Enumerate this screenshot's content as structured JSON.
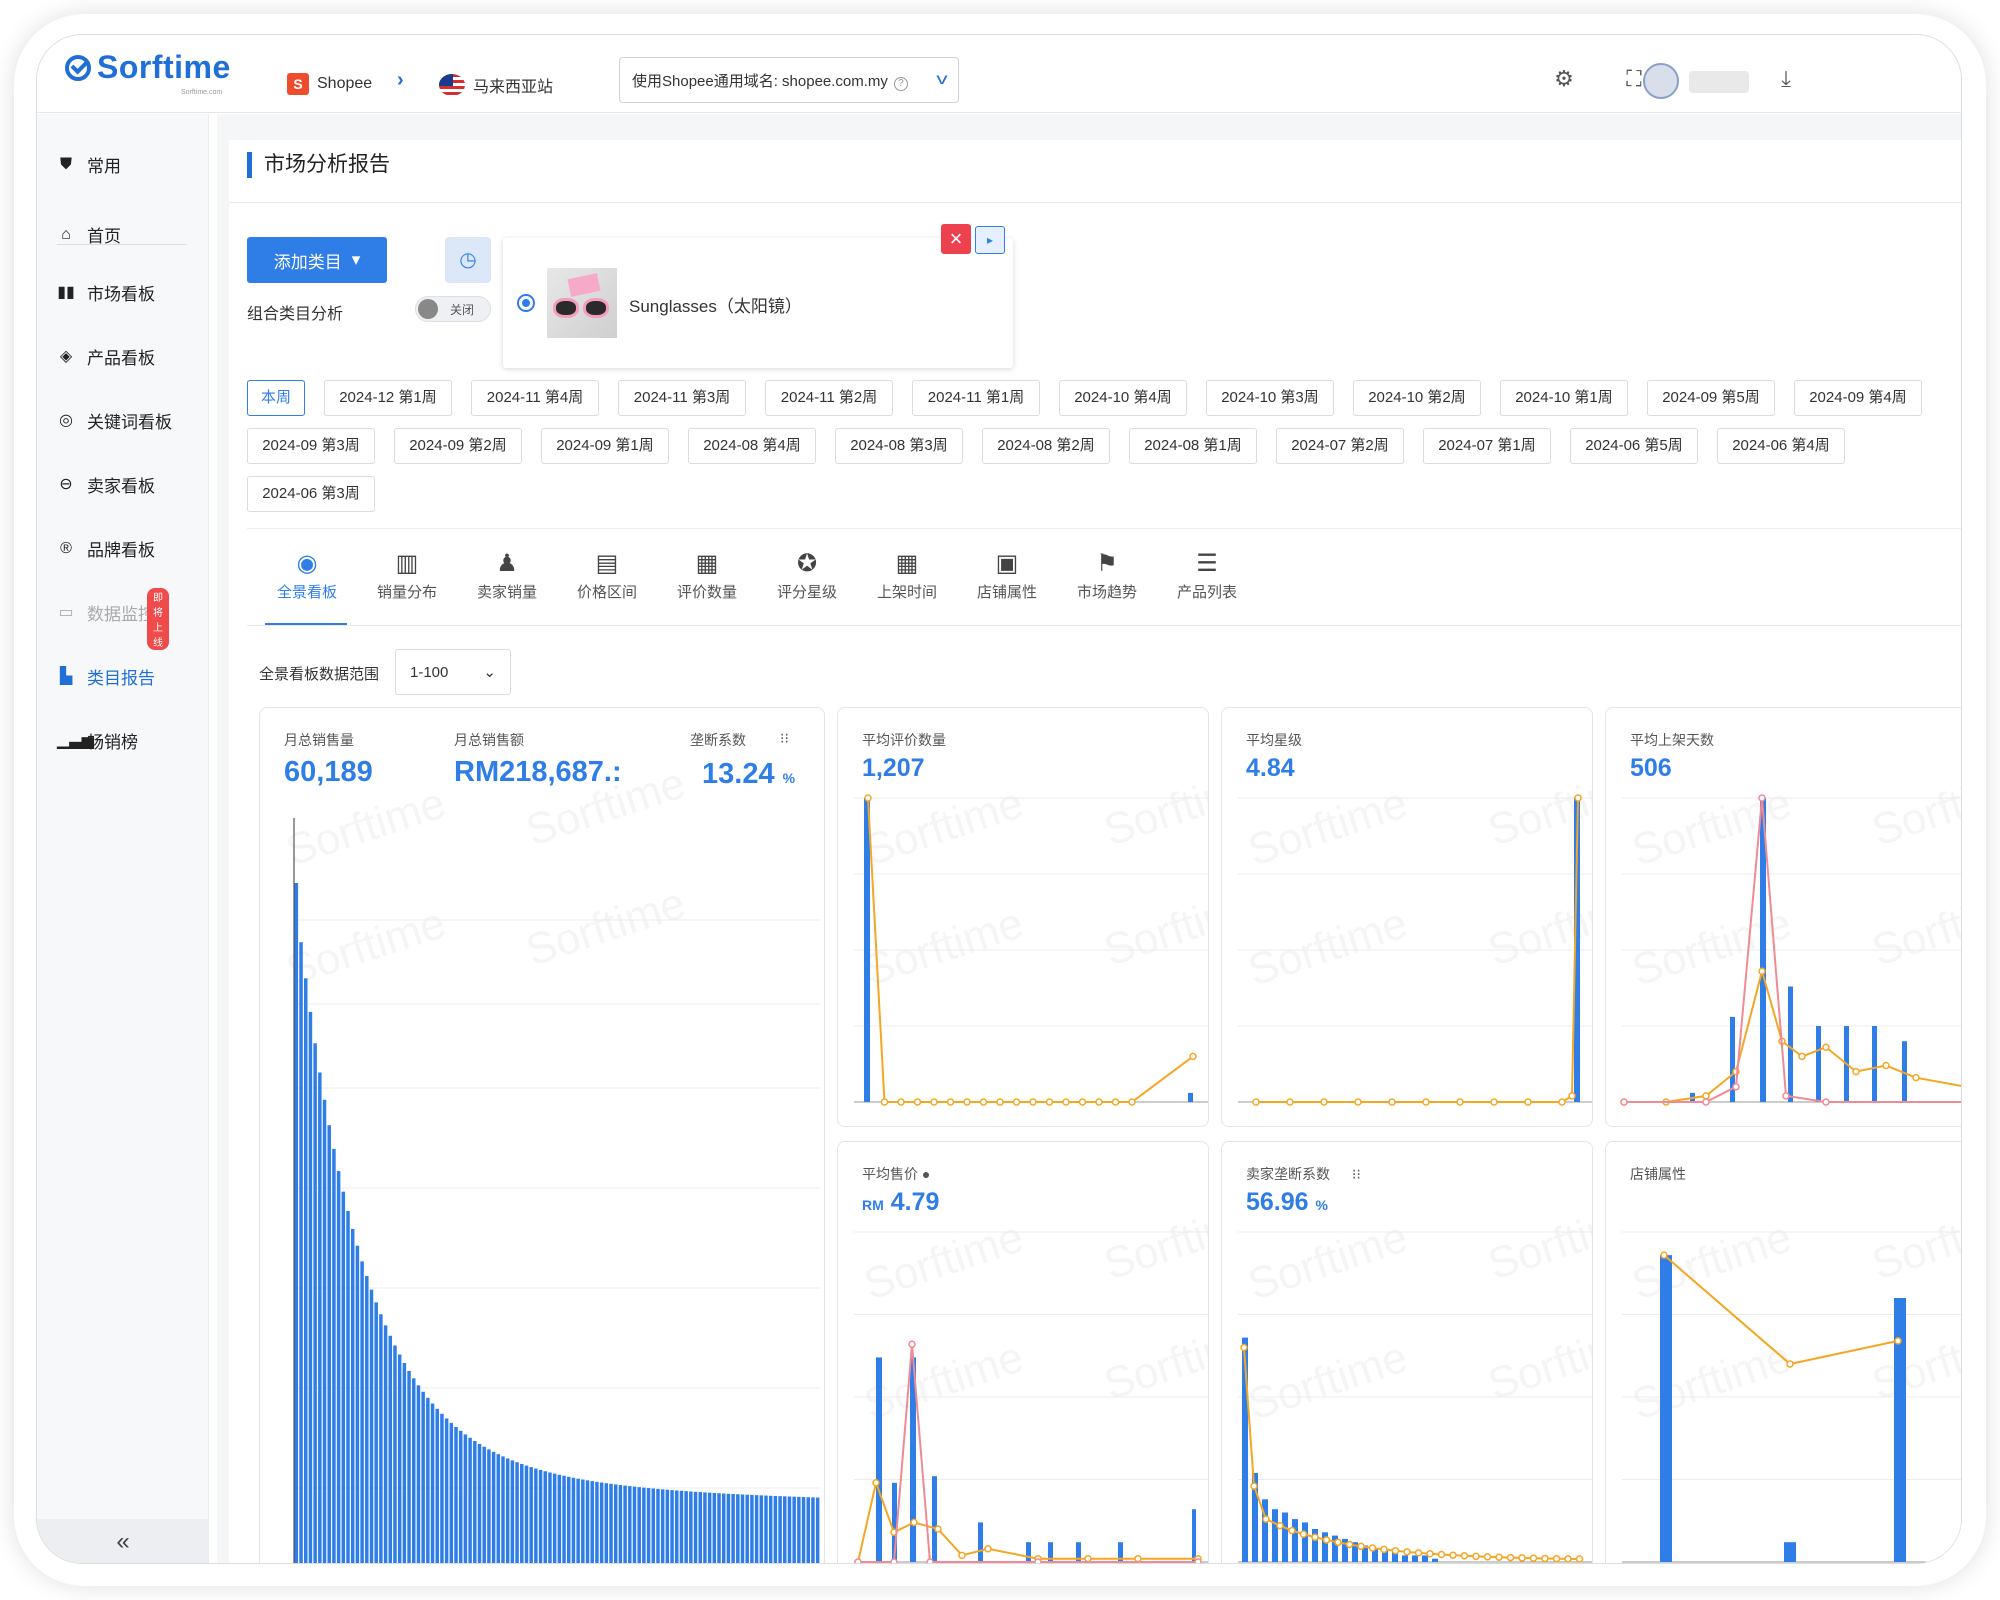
{
  "app": {
    "name": "Sorftime",
    "tagline": "Sorftime.com"
  },
  "breadcrumb": {
    "platform": "Shopee",
    "site": "马来西亚站"
  },
  "domain_select": {
    "label": "使用Shopee通用域名: shopee.com.my"
  },
  "sidebar": {
    "items": [
      {
        "label": "常用",
        "icon": "shield-icon"
      },
      {
        "label": "首页",
        "icon": "home-icon"
      },
      {
        "label": "市场看板",
        "icon": "market-icon"
      },
      {
        "label": "产品看板",
        "icon": "box-icon"
      },
      {
        "label": "关键词看板",
        "icon": "target-icon"
      },
      {
        "label": "卖家看板",
        "icon": "seller-icon"
      },
      {
        "label": "品牌看板",
        "icon": "registered-icon"
      },
      {
        "label": "数据监控",
        "icon": "monitor-icon",
        "badge": "即将上线"
      },
      {
        "label": "类目报告",
        "icon": "report-icon"
      },
      {
        "label": "畅销榜",
        "icon": "bar-chart-icon"
      }
    ],
    "collapse": "«"
  },
  "page": {
    "title": "市场分析报告"
  },
  "controls": {
    "add_category": "添加类目",
    "combo_label": "组合类目分析",
    "toggle_label": "关闭"
  },
  "category": {
    "name": "Sunglasses（太阳镜）"
  },
  "weeks": [
    "本周",
    "2024-12 第1周",
    "2024-11 第4周",
    "2024-11 第3周",
    "2024-11 第2周",
    "2024-11 第1周",
    "2024-10 第4周",
    "2024-10 第3周",
    "2024-10 第2周",
    "2024-10 第1周",
    "2024-09 第5周",
    "2024-09 第4周",
    "2024-09 第3周",
    "2024-09 第2周",
    "2024-09 第1周",
    "2024-08 第4周",
    "2024-08 第3周",
    "2024-08 第2周",
    "2024-08 第1周",
    "2024-07 第2周",
    "2024-07 第1周",
    "2024-06 第5周",
    "2024-06 第4周",
    "2024-06 第3周"
  ],
  "tabs": [
    {
      "label": "全景看板",
      "icon": "dashboard-icon"
    },
    {
      "label": "销量分布",
      "icon": "sales-chart-icon"
    },
    {
      "label": "卖家销量",
      "icon": "seller-sales-icon"
    },
    {
      "label": "价格区间",
      "icon": "price-icon"
    },
    {
      "label": "评价数量",
      "icon": "review-icon"
    },
    {
      "label": "评分星级",
      "icon": "star-icon"
    },
    {
      "label": "上架时间",
      "icon": "calendar-icon"
    },
    {
      "label": "店铺属性",
      "icon": "store-icon"
    },
    {
      "label": "市场趋势",
      "icon": "trend-icon"
    },
    {
      "label": "产品列表",
      "icon": "list-icon"
    }
  ],
  "range": {
    "label": "全景看板数据范围",
    "value": "1-100"
  },
  "stats": {
    "monthly_sales": {
      "label": "月总销售量",
      "value": "60,189"
    },
    "monthly_revenue": {
      "label": "月总销售额",
      "value": "RM218,687.:"
    },
    "monopoly": {
      "label": "垄断系数",
      "value": "13.24",
      "unit": "%"
    },
    "avg_reviews": {
      "label": "平均评价数量",
      "value": "1,207"
    },
    "avg_rating": {
      "label": "平均星级",
      "value": "4.84"
    },
    "avg_days": {
      "label": "平均上架天数",
      "value": "506"
    },
    "avg_price": {
      "label": "平均售价",
      "value": "4.79",
      "currency": "RM"
    },
    "seller_monopoly": {
      "label": "卖家垄断系数",
      "value": "56.96",
      "unit": "%"
    },
    "store_attr": {
      "label": "店铺属性"
    }
  },
  "watermark": "Sorftime",
  "colors": {
    "accent": "#2f7ee8",
    "line_orange": "#f5a623",
    "line_pink": "#f08a94",
    "danger": "#ee4150"
  }
}
